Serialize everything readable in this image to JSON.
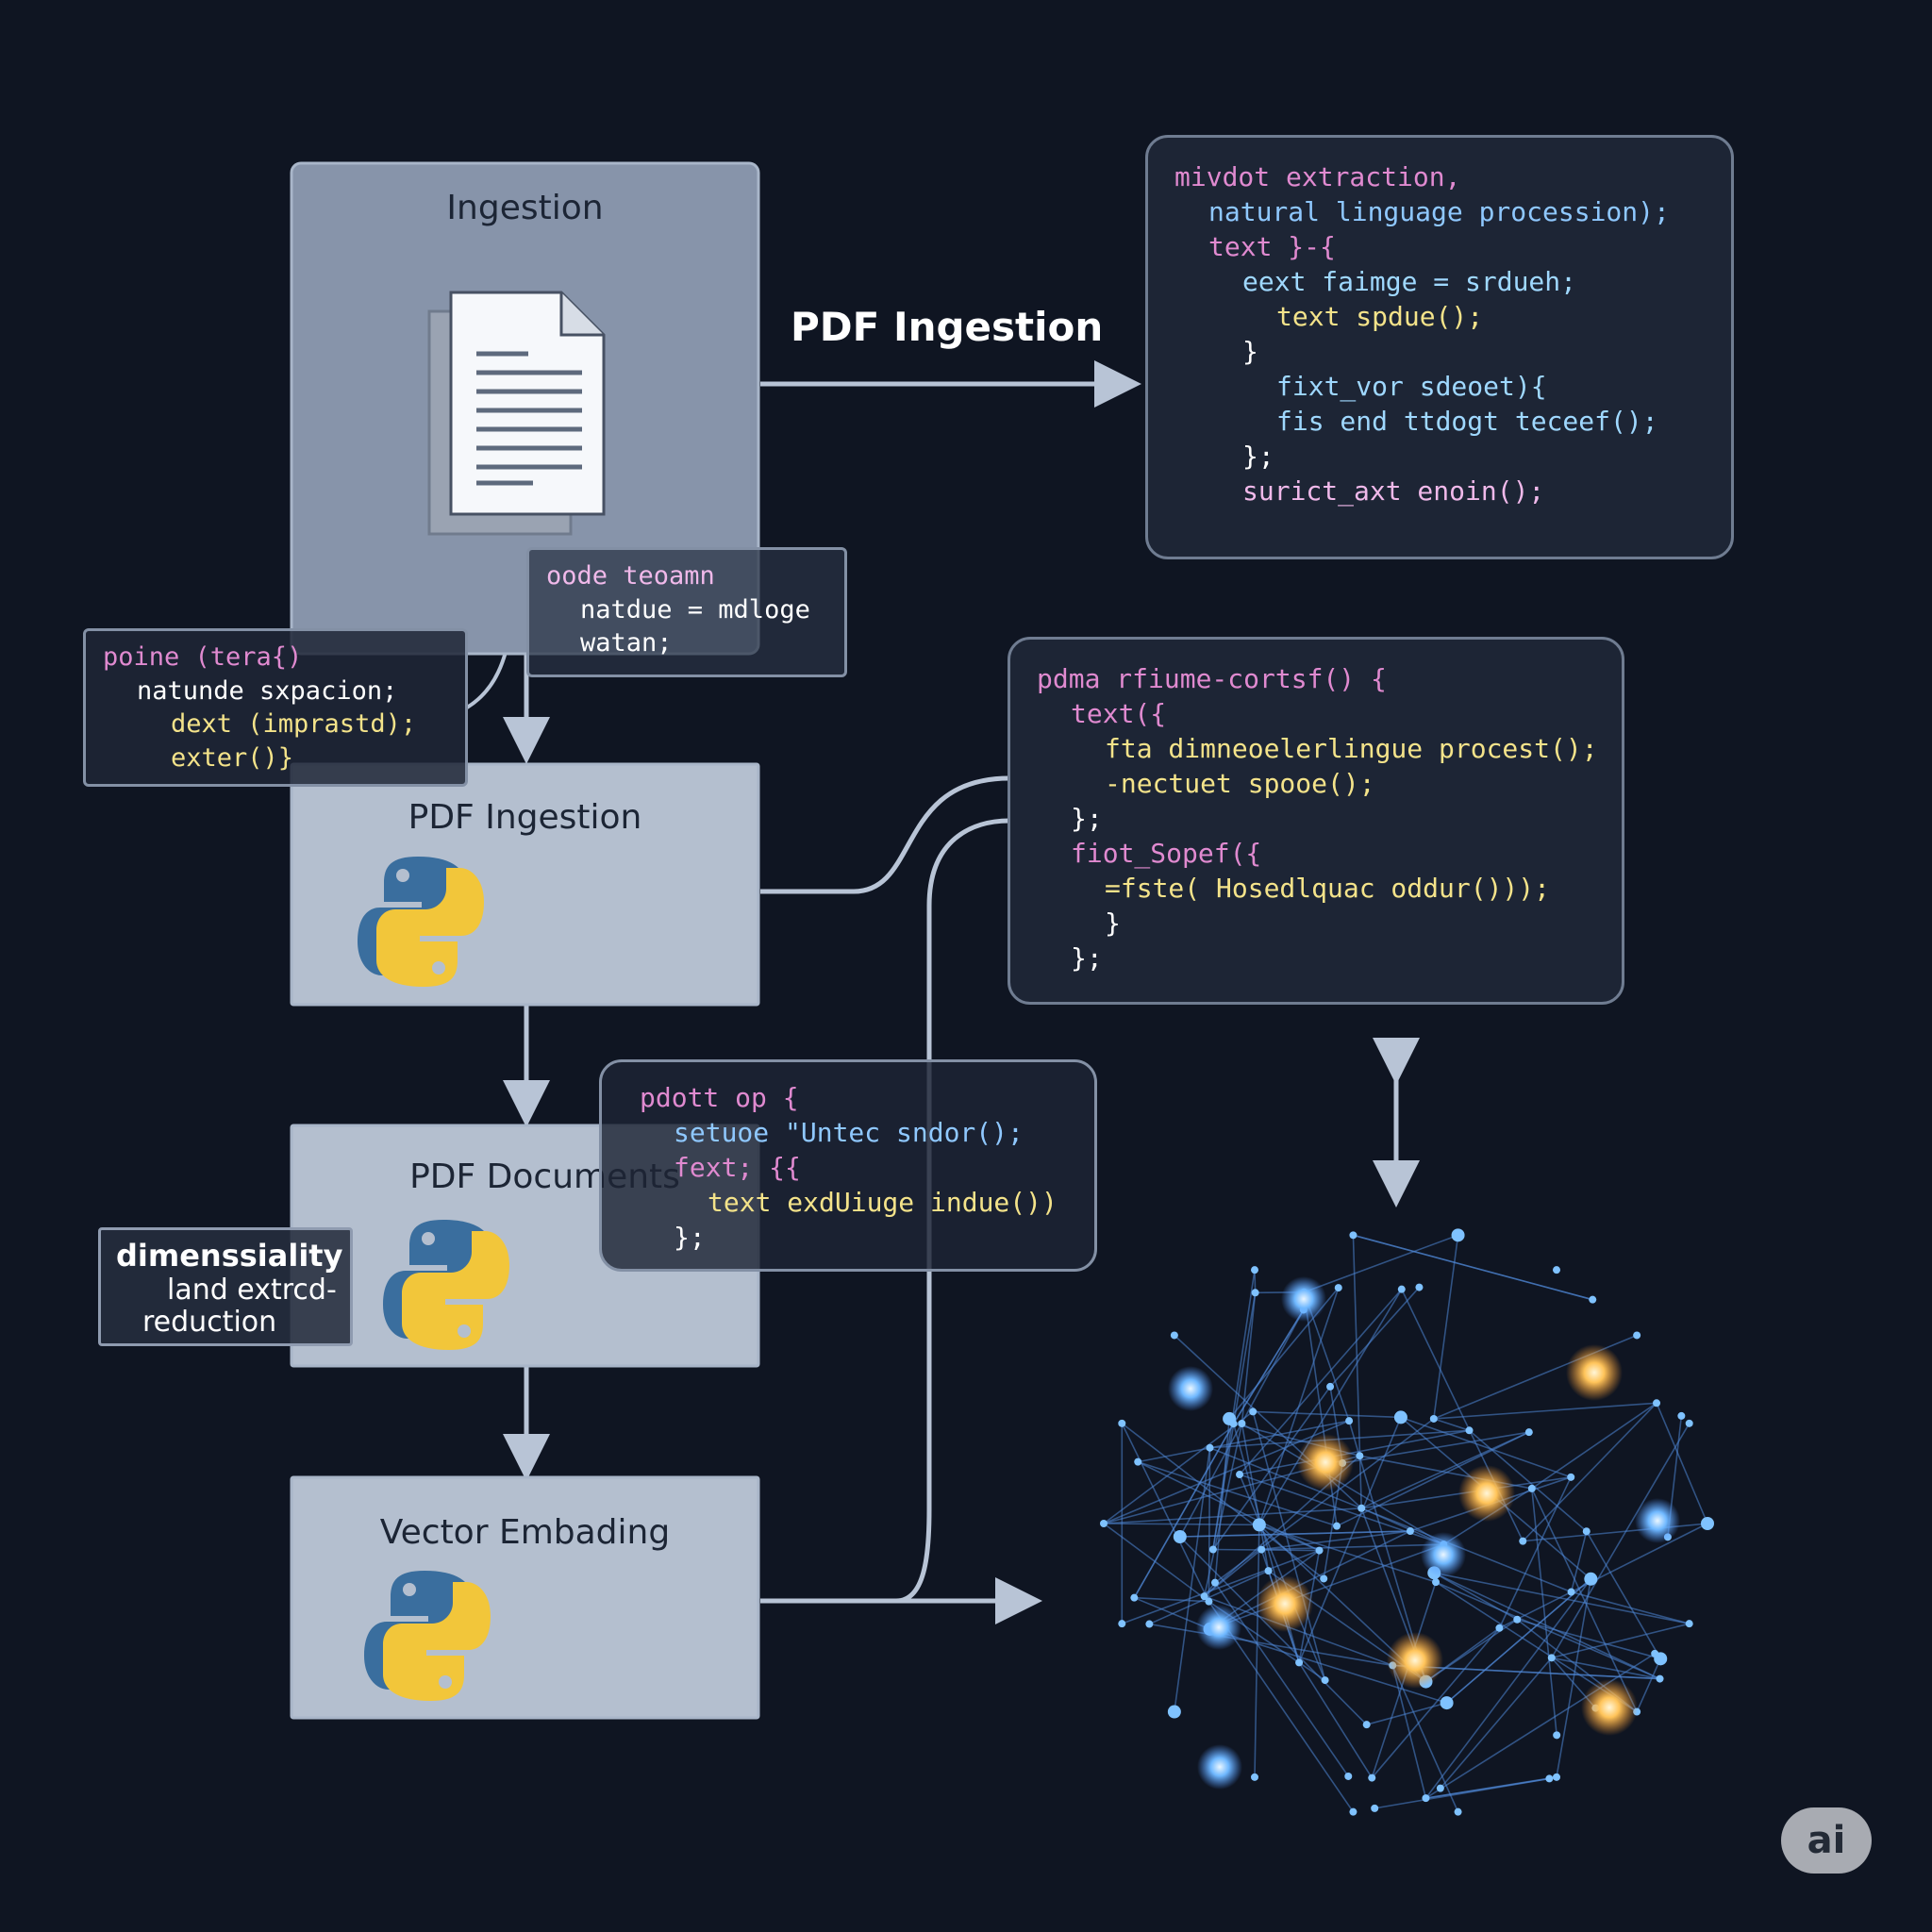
{
  "label_top": "PDF Ingestion",
  "stages": [
    {
      "title": "Ingestion",
      "icon": "document-icon"
    },
    {
      "title": "PDF Ingestion",
      "icon": "python-icon"
    },
    {
      "title": "PDF Documents",
      "icon": "python-icon"
    },
    {
      "title": "Vector Embading",
      "icon": "python-icon"
    }
  ],
  "note": {
    "line1": "dimenssiality",
    "line2": "land extrcd-",
    "line3": "reduction"
  },
  "code_blocks": {
    "top_right": [
      {
        "text": "mivdot extraction,",
        "color": "#e08ad0",
        "indent": 0
      },
      {
        "text": "natural linguage procession);",
        "color": "#8fc8ff",
        "indent": 1
      },
      {
        "text": "text }-{",
        "color": "#e08ad0",
        "indent": 1
      },
      {
        "text": "eext faimge = srdueh;",
        "color": "#9fd8ff",
        "indent": 2
      },
      {
        "text": "text spdue();",
        "color": "#f4e38a",
        "indent": 3
      },
      {
        "text": "}",
        "color": "#ffffff",
        "indent": 2
      },
      {
        "text": "fixt_vor sdeoet){",
        "color": "#9fd8ff",
        "indent": 3
      },
      {
        "text": "fis end ttdogt teceef();",
        "color": "#9fd8ff",
        "indent": 3
      },
      {
        "text": "};",
        "color": "#ffffff",
        "indent": 2
      },
      {
        "text": "surict_axt enoin();",
        "color": "#f0b9ea",
        "indent": 2
      }
    ],
    "middle_right": [
      {
        "text": "pdma rfiume-cortsf() {",
        "color": "#e08ad0",
        "indent": 0
      },
      {
        "text": "text({",
        "color": "#e08ad0",
        "indent": 1
      },
      {
        "text": "fta dimneoelerlingue procest();",
        "color": "#f4e38a",
        "indent": 2
      },
      {
        "text": "-nectuet spooe();",
        "color": "#f4e38a",
        "indent": 2
      },
      {
        "text": "};",
        "color": "#ffffff",
        "indent": 1
      },
      {
        "text": "fiot_Sopef({",
        "color": "#e08ad0",
        "indent": 1
      },
      {
        "text": "=fste( Hosedlquac oddur()));",
        "color": "#f4e38a",
        "indent": 2
      },
      {
        "text": "}",
        "color": "#ffffff",
        "indent": 2
      },
      {
        "text": "};",
        "color": "#ffffff",
        "indent": 1
      }
    ],
    "small_top": [
      {
        "text": "oode teoamn",
        "color": "#f0b9ea",
        "indent": 0
      },
      {
        "text": "natdue = mdloge",
        "color": "#ffffff",
        "indent": 1
      },
      {
        "text": "watan;",
        "color": "#ffffff",
        "indent": 1
      }
    ],
    "small_left": [
      {
        "text": "poine (tera{)",
        "color": "#e08ad0",
        "indent": 0
      },
      {
        "text": "natunde sxpacion;",
        "color": "#ffffff",
        "indent": 1
      },
      {
        "text": "dext (imprastd);",
        "color": "#f4e38a",
        "indent": 2
      },
      {
        "text": "exter()}",
        "color": "#f4e38a",
        "indent": 2
      }
    ],
    "bottom_mid": [
      {
        "text": "pdott op {",
        "color": "#e08ad0",
        "indent": 0
      },
      {
        "text": "setuoe \"Untec sndor();",
        "color": "#8fc8ff",
        "indent": 1
      },
      {
        "text": "fext; {{",
        "color": "#e08ad0",
        "indent": 1
      },
      {
        "text": "text exdUiuge indue())",
        "color": "#f4e38a",
        "indent": 2
      },
      {
        "text": "};",
        "color": "#ffffff",
        "indent": 1
      }
    ]
  },
  "badge": "ai",
  "colors": {
    "background": "#0f1522",
    "stage_fill": "#b4bfcf",
    "stage_fill_top": "#8794aa",
    "connector": "#b8c4d6",
    "python_blue": "#3a6e9e",
    "python_yellow": "#f2c63a",
    "node_blue": "#7fc2ff",
    "node_orange": "#ffc45a"
  }
}
